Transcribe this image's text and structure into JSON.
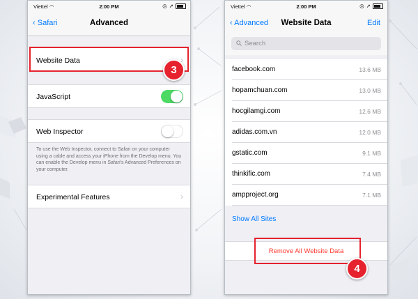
{
  "colors": {
    "accent": "#007aff",
    "toggle_on": "#4cd964",
    "destructive": "#ff3b30",
    "annotation_red": "#e5222e"
  },
  "left_screen": {
    "status": {
      "carrier": "Viettel",
      "time": "2:00 PM"
    },
    "nav": {
      "back_label": "Safari",
      "title": "Advanced"
    },
    "website_data_label": "Website Data",
    "javascript_label": "JavaScript",
    "javascript_on": true,
    "web_inspector_label": "Web Inspector",
    "web_inspector_on": false,
    "web_inspector_note": "To use the Web Inspector, connect to Safari on your computer using a cable and access your iPhone from the Develop menu. You can enable the Develop menu in Safari's Advanced Preferences on your computer.",
    "experimental_label": "Experimental Features",
    "step_badge": "3"
  },
  "right_screen": {
    "status": {
      "carrier": "Viettel",
      "time": "2:00 PM"
    },
    "nav": {
      "back_label": "Advanced",
      "title": "Website Data",
      "edit_label": "Edit"
    },
    "search_placeholder": "Search",
    "sites": [
      {
        "domain": "facebook.com",
        "size": "13.6 MB"
      },
      {
        "domain": "hopamchuan.com",
        "size": "13.0 MB"
      },
      {
        "domain": "hocgilamgi.com",
        "size": "12.6 MB"
      },
      {
        "domain": "adidas.com.vn",
        "size": "12.0 MB"
      },
      {
        "domain": "gstatic.com",
        "size": "9.1 MB"
      },
      {
        "domain": "thinkific.com",
        "size": "7.4 MB"
      },
      {
        "domain": "ampproject.org",
        "size": "7.1 MB"
      }
    ],
    "show_all_label": "Show All Sites",
    "remove_all_label": "Remove All Website Data",
    "step_badge": "4"
  }
}
